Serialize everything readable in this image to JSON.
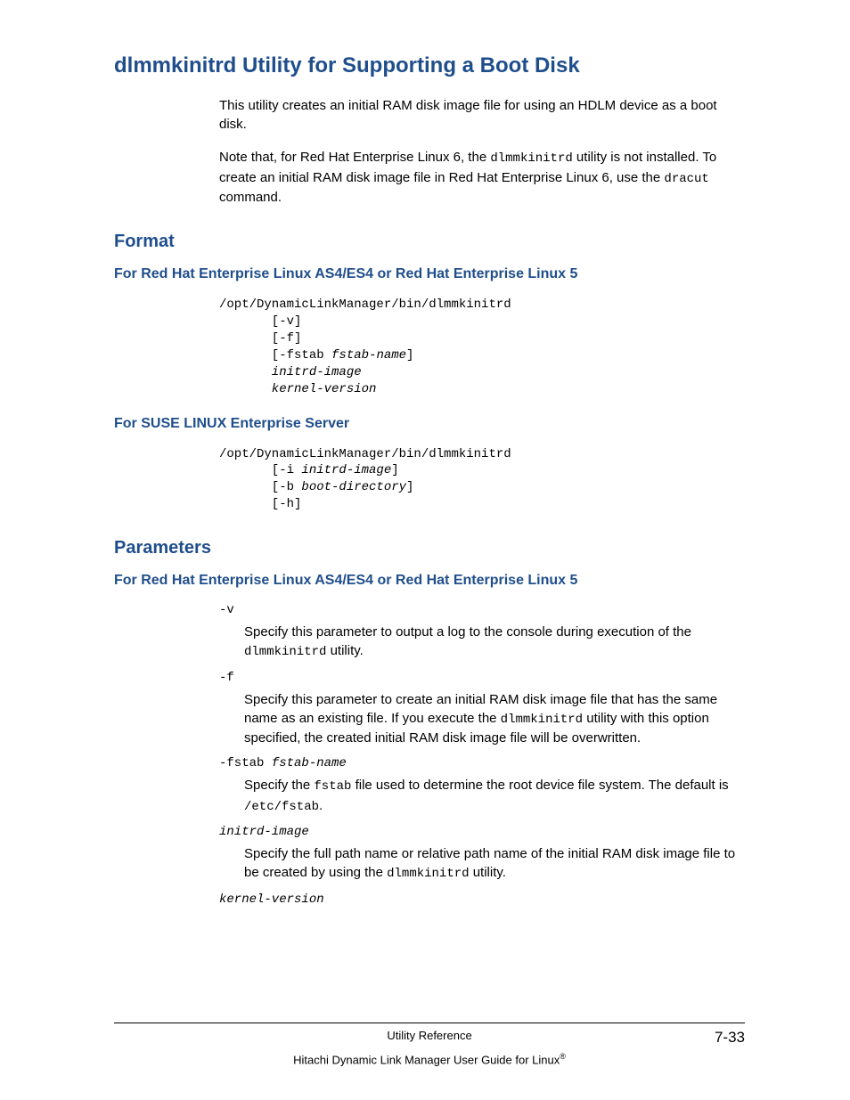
{
  "title": "dlmmkinitrd Utility for Supporting a Boot Disk",
  "intro": {
    "p1": "This utility creates an initial RAM disk image file for using an HDLM device as a boot disk.",
    "p2_a": "Note that, for Red Hat Enterprise Linux 6, the ",
    "p2_code1": "dlmmkinitrd",
    "p2_b": " utility is not installed. To create an initial RAM disk image file in Red Hat Enterprise Linux 6, use the ",
    "p2_code2": "dracut",
    "p2_c": " command."
  },
  "format": {
    "heading": "Format",
    "rhel": {
      "heading": "For Red Hat Enterprise Linux AS4/ES4 or Red Hat Enterprise Linux 5",
      "line1": "/opt/DynamicLinkManager/bin/dlmmkinitrd",
      "line2a": "       [-v]",
      "line3a": "       [-f]",
      "line4a": "       [-fstab ",
      "line4b": "fstab-name",
      "line4c": "]",
      "line5": "       initrd-image",
      "line6": "       kernel-version"
    },
    "suse": {
      "heading": "For SUSE LINUX Enterprise Server",
      "line1": "/opt/DynamicLinkManager/bin/dlmmkinitrd",
      "line2a": "       [-i ",
      "line2b": "initrd-image",
      "line2c": "]",
      "line3a": "       [-b ",
      "line3b": "boot-directory",
      "line3c": "]",
      "line4": "       [-h]"
    }
  },
  "parameters": {
    "heading": "Parameters",
    "rhel": {
      "heading": "For Red Hat Enterprise Linux AS4/ES4 or Red Hat Enterprise Linux 5",
      "v": {
        "term": "-v",
        "desc_a": "Specify this parameter to output a log to the console during execution of the ",
        "desc_code": "dlmmkinitrd",
        "desc_b": " utility."
      },
      "f": {
        "term": "-f",
        "desc_a": "Specify this parameter to create an initial RAM disk image file that has the same name as an existing file. If you execute the ",
        "desc_code": "dlmmkinitrd",
        "desc_b": " utility with this option specified, the created initial RAM disk image file will be overwritten."
      },
      "fstab": {
        "term_a": "-fstab ",
        "term_b": "fstab-name",
        "desc_a": "Specify the ",
        "desc_code1": "fstab",
        "desc_b": " file used to determine the root device file system. The default is ",
        "desc_code2": "/etc/fstab",
        "desc_c": "."
      },
      "initrd": {
        "term": "initrd-image",
        "desc_a": "Specify the full path name or relative path name of the initial RAM disk image file to be created by using the ",
        "desc_code": "dlmmkinitrd",
        "desc_b": " utility."
      },
      "kernel": {
        "term": "kernel-version"
      }
    }
  },
  "footer": {
    "center": "Utility Reference",
    "pagenum": "7-33",
    "line2": "Hitachi Dynamic Link Manager User Guide for Linux",
    "reg": "®"
  }
}
